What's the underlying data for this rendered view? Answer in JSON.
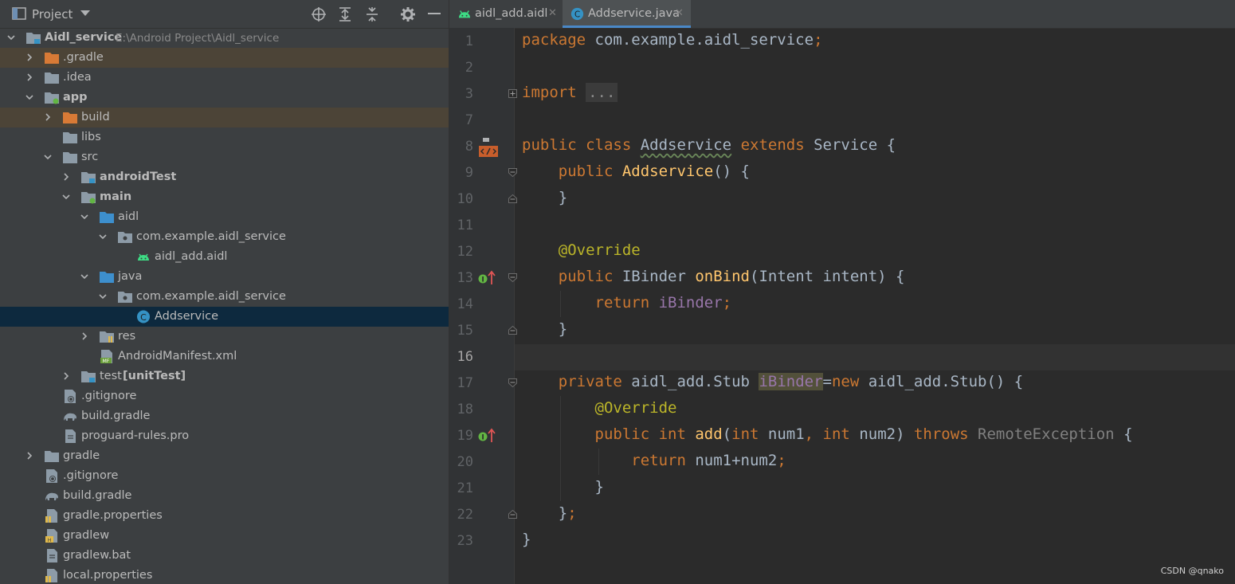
{
  "project_panel": {
    "title": "Project",
    "tree": [
      {
        "label": "Aidl_service",
        "hint": "E:\\Android Project\\Aidl_service",
        "bold": true
      },
      {
        "label": ".gradle"
      },
      {
        "label": ".idea"
      },
      {
        "label": "app",
        "bold": true
      },
      {
        "label": "build"
      },
      {
        "label": "libs"
      },
      {
        "label": "src"
      },
      {
        "label": "androidTest",
        "bold": true
      },
      {
        "label": "main",
        "bold": true
      },
      {
        "label": "aidl"
      },
      {
        "label": "com.example.aidl_service"
      },
      {
        "label": "aidl_add.aidl"
      },
      {
        "label": "java"
      },
      {
        "label": "com.example.aidl_service"
      },
      {
        "label": "Addservice"
      },
      {
        "label": "res"
      },
      {
        "label": "AndroidManifest.xml"
      },
      {
        "label": "test",
        "bold_part": "[unitTest]"
      },
      {
        "label": ".gitignore"
      },
      {
        "label": "build.gradle"
      },
      {
        "label": "proguard-rules.pro"
      },
      {
        "label": "gradle"
      },
      {
        "label": ".gitignore"
      },
      {
        "label": "build.gradle"
      },
      {
        "label": "gradle.properties"
      },
      {
        "label": "gradlew"
      },
      {
        "label": "gradlew.bat"
      },
      {
        "label": "local.properties"
      }
    ]
  },
  "editor": {
    "tabs": [
      {
        "label": "aidl_add.aidl",
        "active": false
      },
      {
        "label": "Addservice.java",
        "active": true
      }
    ],
    "line_numbers": [
      "1",
      "2",
      "3",
      "7",
      "8",
      "9",
      "10",
      "11",
      "12",
      "13",
      "14",
      "15",
      "16",
      "17",
      "18",
      "19",
      "20",
      "21",
      "22",
      "23"
    ],
    "code": {
      "l1_a": "package",
      "l1_b": " com.example.aidl_service",
      "l1_c": ";",
      "l3_a": "import",
      "l3_b": "...",
      "l8_a": "public class",
      "l8_b": "Addservice",
      "l8_c": "extends",
      "l8_d": " Service {",
      "l9_a": "    public ",
      "l9_b": "Addservice",
      "l9_c": "() {",
      "l10": "    }",
      "l12": "    @Override",
      "l13_a": "    public ",
      "l13_b": "IBinder ",
      "l13_c": "onBind",
      "l13_d": "(Intent intent) {",
      "l14_a": "        return ",
      "l14_b": "iBinder",
      "l14_c": ";",
      "l15": "    }",
      "l17_a": "    private ",
      "l17_b": "aidl_add.Stub ",
      "l17_c": "iBinder",
      "l17_d": "=",
      "l17_e": "new ",
      "l17_f": "aidl_add.Stub() {",
      "l18": "        @Override",
      "l19_a": "        public int ",
      "l19_b": "add",
      "l19_c": "(",
      "l19_d": "int ",
      "l19_e": "num1",
      "l19_f": ", ",
      "l19_g": "int ",
      "l19_h": "num2) ",
      "l19_i": "throws ",
      "l19_j": "RemoteException",
      "l19_k": " {",
      "l20_a": "            return ",
      "l20_b": "num1+num2",
      "l20_c": ";",
      "l21": "        }",
      "l22_a": "    }",
      "l22_b": ";",
      "l23": "}"
    }
  },
  "watermark": "CSDN @qnako",
  "colors": {
    "keyword": "#cc7832",
    "function": "#ffc66d",
    "annotation": "#bbb529",
    "field": "#9876aa",
    "text": "#a9b7c6",
    "selection": "#0d293e",
    "excluded": "#4c4437"
  }
}
